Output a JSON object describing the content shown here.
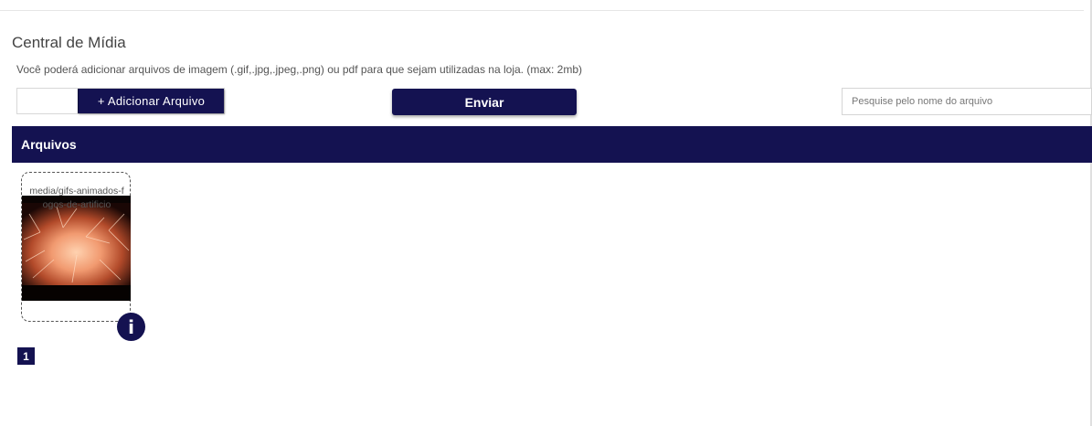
{
  "header": {
    "title": "Central de Mídia",
    "description": "Você poderá adicionar arquivos de imagem (.gif,.jpg,.jpeg,.png) ou pdf para que sejam utilizadas na loja. (max: 2mb)"
  },
  "upload": {
    "add_file_label": "+ Adicionar Arquivo",
    "send_label": "Enviar"
  },
  "search": {
    "placeholder": "Pesquise pelo nome do arquivo",
    "value": ""
  },
  "files": {
    "header_label": "Arquivos",
    "items": [
      {
        "name": "media/gifs-animados-fogos-de-artificio",
        "info_icon": "info-icon",
        "info_label": "i"
      }
    ]
  },
  "pagination": {
    "current_page": "1"
  },
  "colors": {
    "brand": "#141251",
    "text": "#444444"
  }
}
